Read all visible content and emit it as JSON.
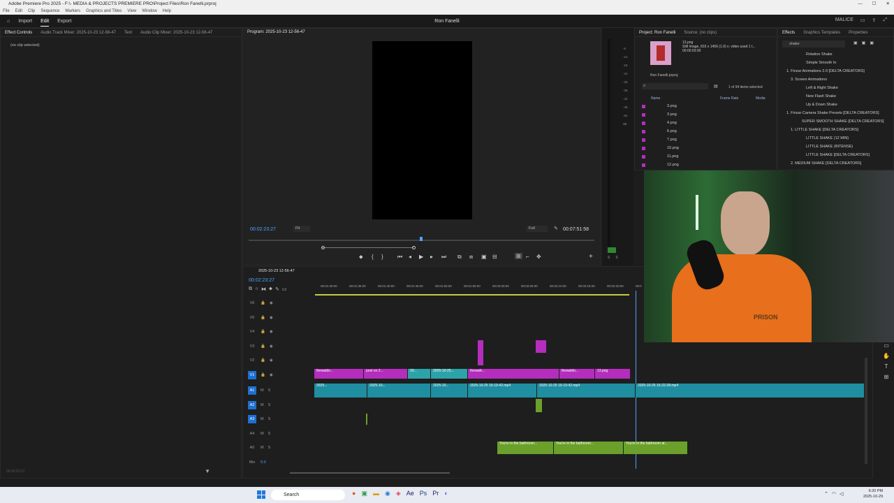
{
  "window": {
    "title": "Adobe Premiere Pro 2025 - F:\\- MEDIA & PROJECTS PREMIERE PRO\\Project Files\\Ron Fanelli.prproj"
  },
  "menu": [
    "File",
    "Edit",
    "Clip",
    "Sequence",
    "Markers",
    "Graphics and Titles",
    "View",
    "Window",
    "Help"
  ],
  "header": {
    "nav": [
      "Import",
      "Edit",
      "Export"
    ],
    "project_title": "Ron Fanelli",
    "right_user": "MALICE"
  },
  "left_panel": {
    "tabs": [
      "Effect Controls",
      "Audio Track Mixer: 2025-10-23 12-56-47",
      "Text",
      "Audio Clip Mixer: 2025-10-23 12-56-47"
    ],
    "empty_text": "(no clip selected)",
    "footer_time": "00:02:23:27"
  },
  "monitor": {
    "tab": "Program: 2025-10-23 12-56-47",
    "timecode": "00:02:23:27",
    "fit": "Fit",
    "quality": "Full",
    "duration": "00:07:51:58"
  },
  "project_panel": {
    "tabs": [
      "Project: Ron Fanelli",
      "Source: (no clips)"
    ],
    "selected_name": "13.png",
    "selected_info": "Still Image, 816 x 1456 (1.0)  v; video used 1 t...",
    "selected_duration": "00:00:03:00",
    "project_file": "Ron Fanelli.prproj",
    "count": "1 of 94 items selected",
    "columns": [
      "Name",
      "Frame Rate",
      "Media"
    ],
    "items": [
      "3.png",
      "3.png",
      "4.png",
      "6.png",
      "7.png",
      "10.png",
      "11.png",
      "12.png"
    ]
  },
  "effects_panel": {
    "tabs": [
      "Effects",
      "Graphics Templates",
      "Properties"
    ],
    "search": "shake",
    "items": [
      "Rotation Shake",
      "Simple Smooth In",
      "1. Finzar Animations 2.0 [DELTA CREATORS]",
      "3. Screen Animations",
      "Left & Right Shake",
      "New Flash Shake",
      "Up & Down Shake",
      "1. Finzar Camera Shake Presets [DELTA CREATORS]",
      "SUPER SMOOTH SHAKE [DELTA CREATORS]",
      "1. LITTLE SHAKE [DELTA CREATORS]",
      "LITTLE SHAKE (12 MIN)",
      "LITTLE SHAKE (INTENSE)",
      "LITTLE SHAKE [DELTA CREATORS]",
      "2. MEDIUM SHAKE [DELTA CREATORS]"
    ]
  },
  "meter_scale": [
    "-6",
    "-12",
    "-18",
    "-24",
    "-30",
    "-36",
    "-42",
    "-48",
    "-54",
    "dB"
  ],
  "meter_foot": [
    "S",
    "S"
  ],
  "timeline": {
    "sequence": "2025-10-23 12-56-47",
    "timecode": "00:02:23:27",
    "ruler": [
      "00:01:30:00",
      "00:01:35:00",
      "00:01:40:00",
      "00:01:45:00",
      "00:01:50:00",
      "00:01:55:00",
      "00:02:00:00",
      "00:02:05:00",
      "00:02:10:00",
      "00:02:15:00",
      "00:02:20:00",
      "00:0"
    ],
    "tracks": [
      "V6",
      "V5",
      "V4",
      "V3",
      "V2",
      "V1",
      "A1",
      "A2",
      "A3",
      "A4",
      "A5"
    ],
    "mix_label": "Mix",
    "mix_value": "0.0",
    "v1_clips": [
      "thewaldo...",
      "post on 2...",
      "20...",
      "2025-10-25...",
      "thewalk...",
      "thewaldo...",
      "13.png"
    ],
    "a1_clips": [
      "2025...",
      "2025-10...",
      "2025-10...",
      "2025-10-25 15-19-42.mp4",
      "2025-10-25 15-19-42.mp4",
      "2025-10-25 15-22-28.mp4"
    ],
    "a5_clips": [
      "You're in the bathroom...",
      "You're in the bathroom...",
      "You're in the bathroom at..."
    ]
  },
  "taskbar": {
    "search": "Search",
    "time": "6:20 PM",
    "date": "2025-10-29"
  },
  "webcam": {
    "shirt_text": "PRISON"
  },
  "colors": {
    "v1_clip": "#b42dbd",
    "audio_clip": "#1f8ea0",
    "music_clip": "#6ba02b",
    "accent": "#1d6fd1"
  }
}
